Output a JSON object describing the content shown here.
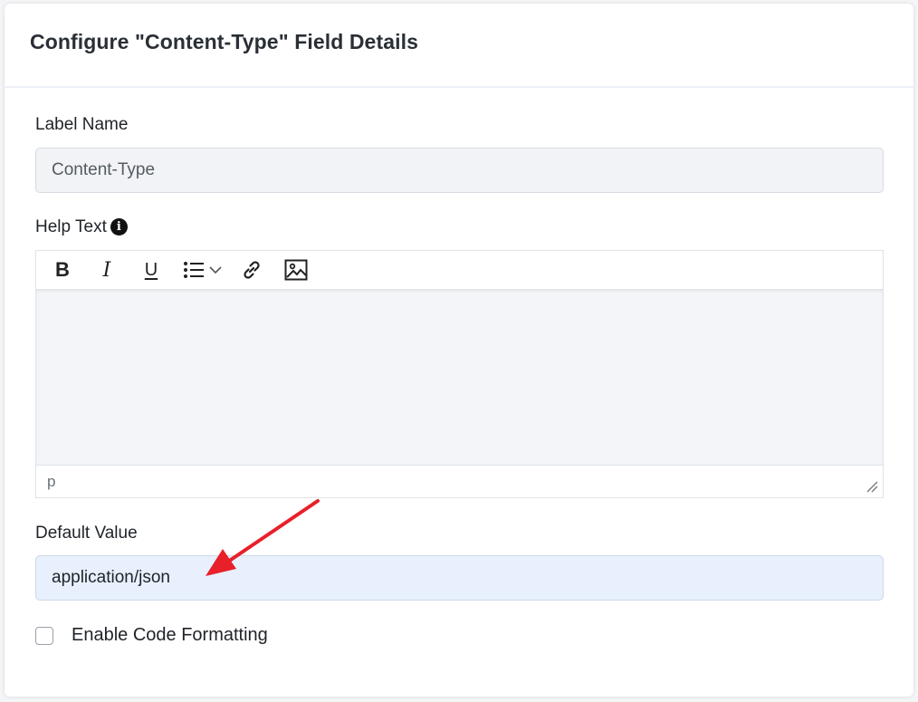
{
  "dialog": {
    "title": "Configure \"Content-Type\" Field Details"
  },
  "label_name": {
    "label": "Label Name",
    "value": "Content-Type"
  },
  "help_text": {
    "label": "Help Text",
    "info_icon": "info-circle-icon",
    "toolbar": {
      "bold": "B",
      "italic": "I",
      "underline": "U",
      "list_icon": "bullet-list-icon",
      "list_dropdown_icon": "chevron-down-icon",
      "link_icon": "link-icon",
      "image_icon": "image-icon"
    },
    "status_path": "p",
    "resize_icon": "resize-handle-icon"
  },
  "default_value": {
    "label": "Default Value",
    "value": "application/json"
  },
  "code_formatting": {
    "label": "Enable Code Formatting",
    "checked": false
  },
  "annotation": {
    "color": "#e8202a"
  }
}
